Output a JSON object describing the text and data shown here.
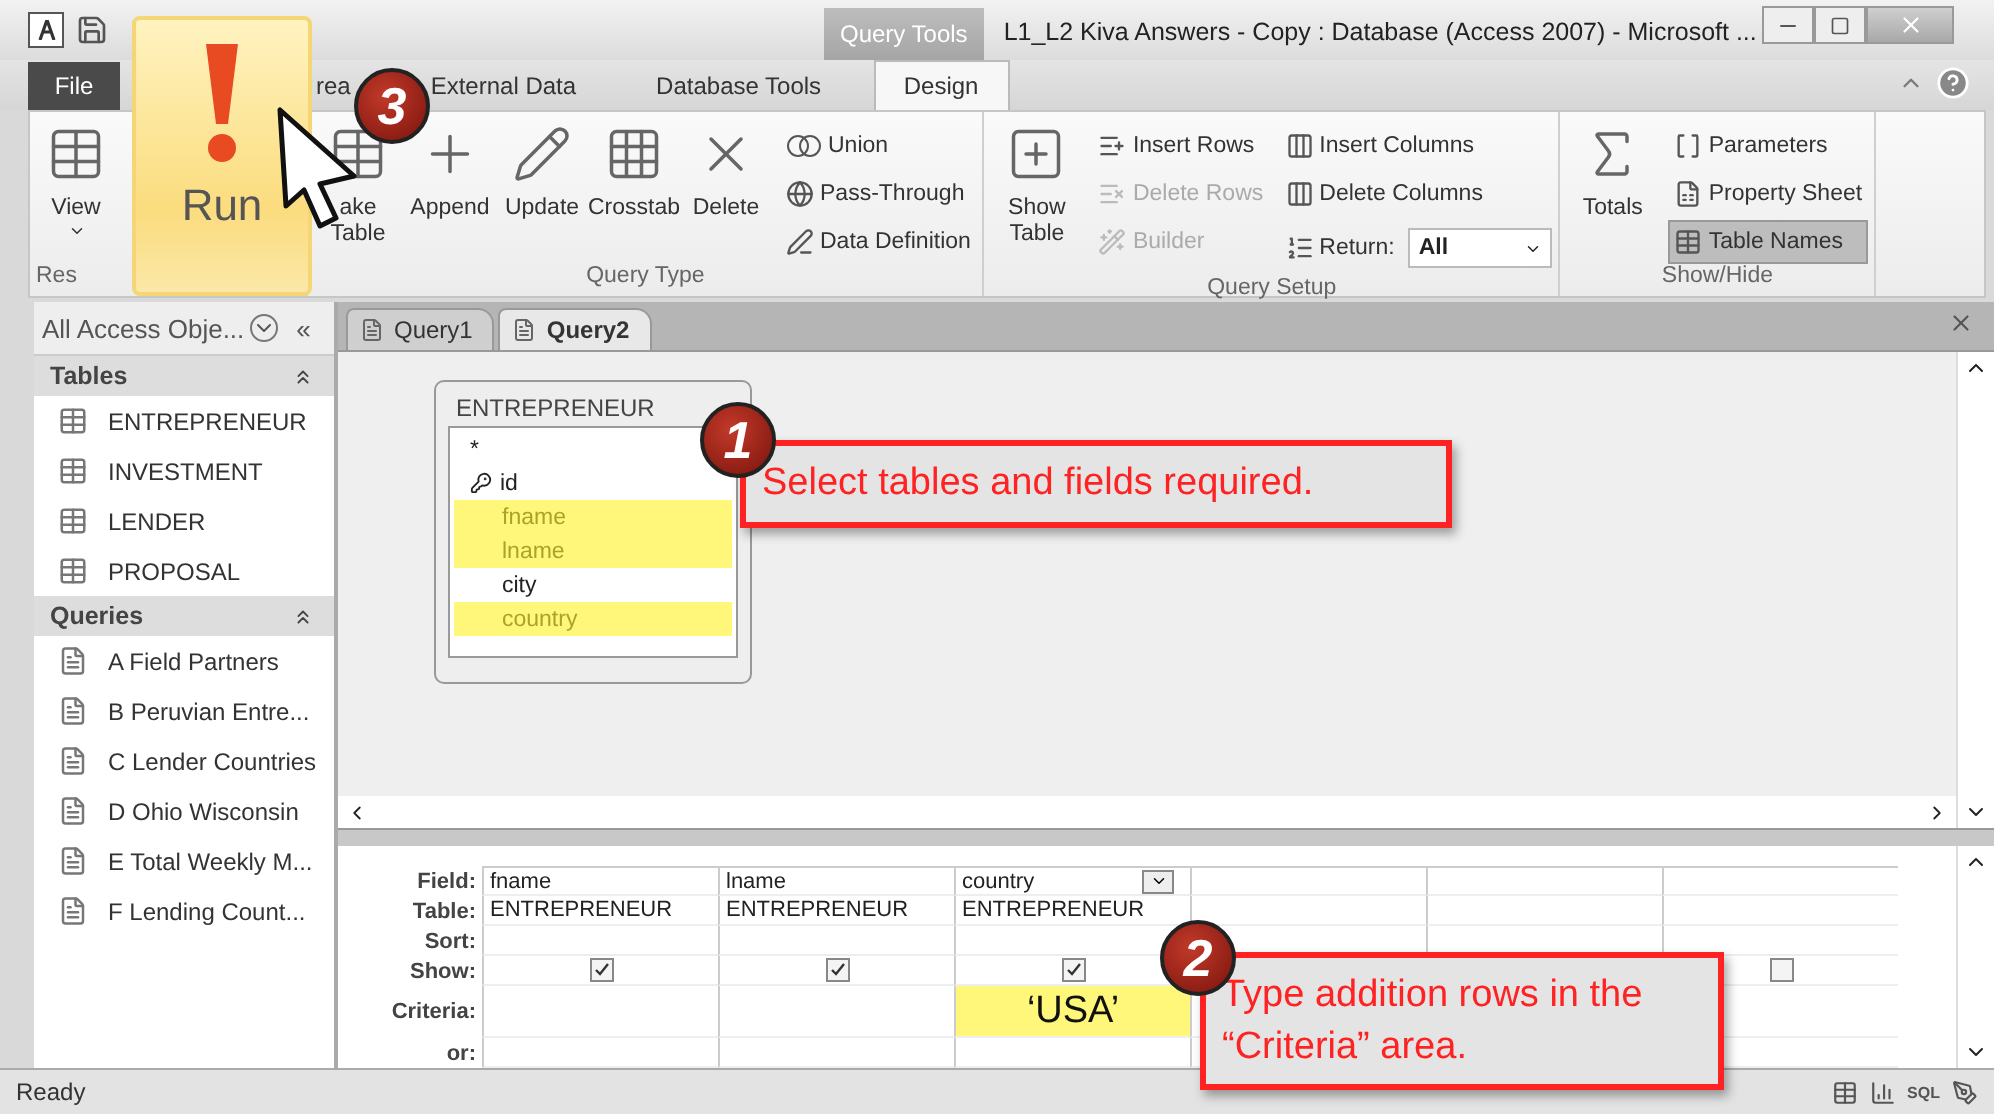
{
  "window": {
    "contextual_tab": "Query Tools",
    "title": "L1_L2 Kiva Answers - Copy : Database (Access 2007)  -  Microsoft ..."
  },
  "ribbon_tabs": [
    {
      "label": "File",
      "kind": "file",
      "selected": false
    },
    {
      "label": "rea",
      "kind": "tab",
      "selected": false
    },
    {
      "label": "External Data",
      "kind": "tab",
      "selected": false
    },
    {
      "label": "Database Tools",
      "kind": "tab",
      "selected": false
    },
    {
      "label": "Design",
      "kind": "tab",
      "selected": true
    }
  ],
  "ribbon_groups": [
    {
      "label": "Res",
      "items": [
        {
          "kind": "large",
          "label": "View",
          "dropdown": true
        }
      ]
    },
    {
      "label": "Query Type",
      "items": [
        {
          "kind": "large",
          "label": "ake Table",
          "dropdown": false
        },
        {
          "kind": "large",
          "label": "Append",
          "dropdown": false
        },
        {
          "kind": "large",
          "label": "Update",
          "dropdown": false
        },
        {
          "kind": "large",
          "label": "Crosstab",
          "dropdown": false
        },
        {
          "kind": "large",
          "label": "Delete",
          "dropdown": false
        },
        {
          "kind": "column",
          "items": [
            {
              "label": "Union",
              "disabled": false,
              "selected": false
            },
            {
              "label": "Pass-Through",
              "disabled": false,
              "selected": false
            },
            {
              "label": "Data Definition",
              "disabled": false,
              "selected": false
            }
          ]
        }
      ]
    },
    {
      "label": "Query Setup",
      "items": [
        {
          "kind": "large",
          "label": "Show Table",
          "dropdown": false
        },
        {
          "kind": "column",
          "items": [
            {
              "label": "Insert Rows",
              "disabled": false,
              "selected": false
            },
            {
              "label": "Delete Rows",
              "disabled": true,
              "selected": false
            },
            {
              "label": "Builder",
              "disabled": true,
              "selected": false
            }
          ]
        },
        {
          "kind": "column",
          "items": [
            {
              "label": "Insert Columns",
              "disabled": false,
              "selected": false
            },
            {
              "label": "Delete Columns",
              "disabled": false,
              "selected": false
            },
            {
              "label": "Return:",
              "disabled": false,
              "selected": false,
              "value": "All"
            }
          ]
        }
      ]
    },
    {
      "label": "Show/Hide",
      "items": [
        {
          "kind": "large",
          "label": "Totals",
          "dropdown": false
        },
        {
          "kind": "column",
          "items": [
            {
              "label": "Parameters",
              "disabled": false,
              "selected": false
            },
            {
              "label": "Property Sheet",
              "disabled": false,
              "selected": false
            },
            {
              "label": "Table Names",
              "disabled": false,
              "selected": true
            }
          ]
        }
      ]
    }
  ],
  "run_button": {
    "label": "Run"
  },
  "nav_pane": {
    "title": "All Access Obje...",
    "collapse": "«",
    "sections": [
      {
        "title": "Tables",
        "kind": "table",
        "items": [
          "ENTREPRENEUR",
          "INVESTMENT",
          "LENDER",
          "PROPOSAL"
        ]
      },
      {
        "title": "Queries",
        "kind": "query",
        "items": [
          "A Field Partners",
          "B Peruvian Entre...",
          "C Lender Countries",
          "D Ohio Wisconsin",
          "E Total Weekly M...",
          "F Lending Count..."
        ]
      }
    ]
  },
  "document_tabs": [
    {
      "label": "Query1",
      "selected": false
    },
    {
      "label": "Query2",
      "selected": true
    }
  ],
  "field_list": {
    "title": "ENTREPRENEUR",
    "fields": [
      {
        "name": "*",
        "key": false,
        "selected": false
      },
      {
        "name": "id",
        "key": true,
        "selected": false
      },
      {
        "name": "fname",
        "key": false,
        "selected": true
      },
      {
        "name": "lname",
        "key": false,
        "selected": true
      },
      {
        "name": "city",
        "key": false,
        "selected": false
      },
      {
        "name": "country",
        "key": false,
        "selected": true
      }
    ]
  },
  "grid": {
    "row_labels": [
      "Field:",
      "Table:",
      "Sort:",
      "Show:",
      "Criteria:",
      "or:"
    ],
    "columns": [
      {
        "field": "fname",
        "table": "ENTREPRENEUR",
        "show": true,
        "dropdown": false
      },
      {
        "field": "lname",
        "table": "ENTREPRENEUR",
        "show": true,
        "dropdown": false
      },
      {
        "field": "country",
        "table": "ENTREPRENEUR",
        "show": true,
        "dropdown": true,
        "criteria": "‘USA’"
      },
      {
        "dropdown": false
      },
      {
        "dropdown": false
      },
      {
        "show": false,
        "dropdown": false
      }
    ]
  },
  "callouts": [
    {
      "number": "1",
      "text": "Select tables and fields required."
    },
    {
      "number": "2",
      "text": "Type addition rows in the “Criteria” area."
    },
    {
      "number": "3"
    }
  ],
  "status_bar": {
    "text": "Ready",
    "view_sql": "SQL"
  }
}
